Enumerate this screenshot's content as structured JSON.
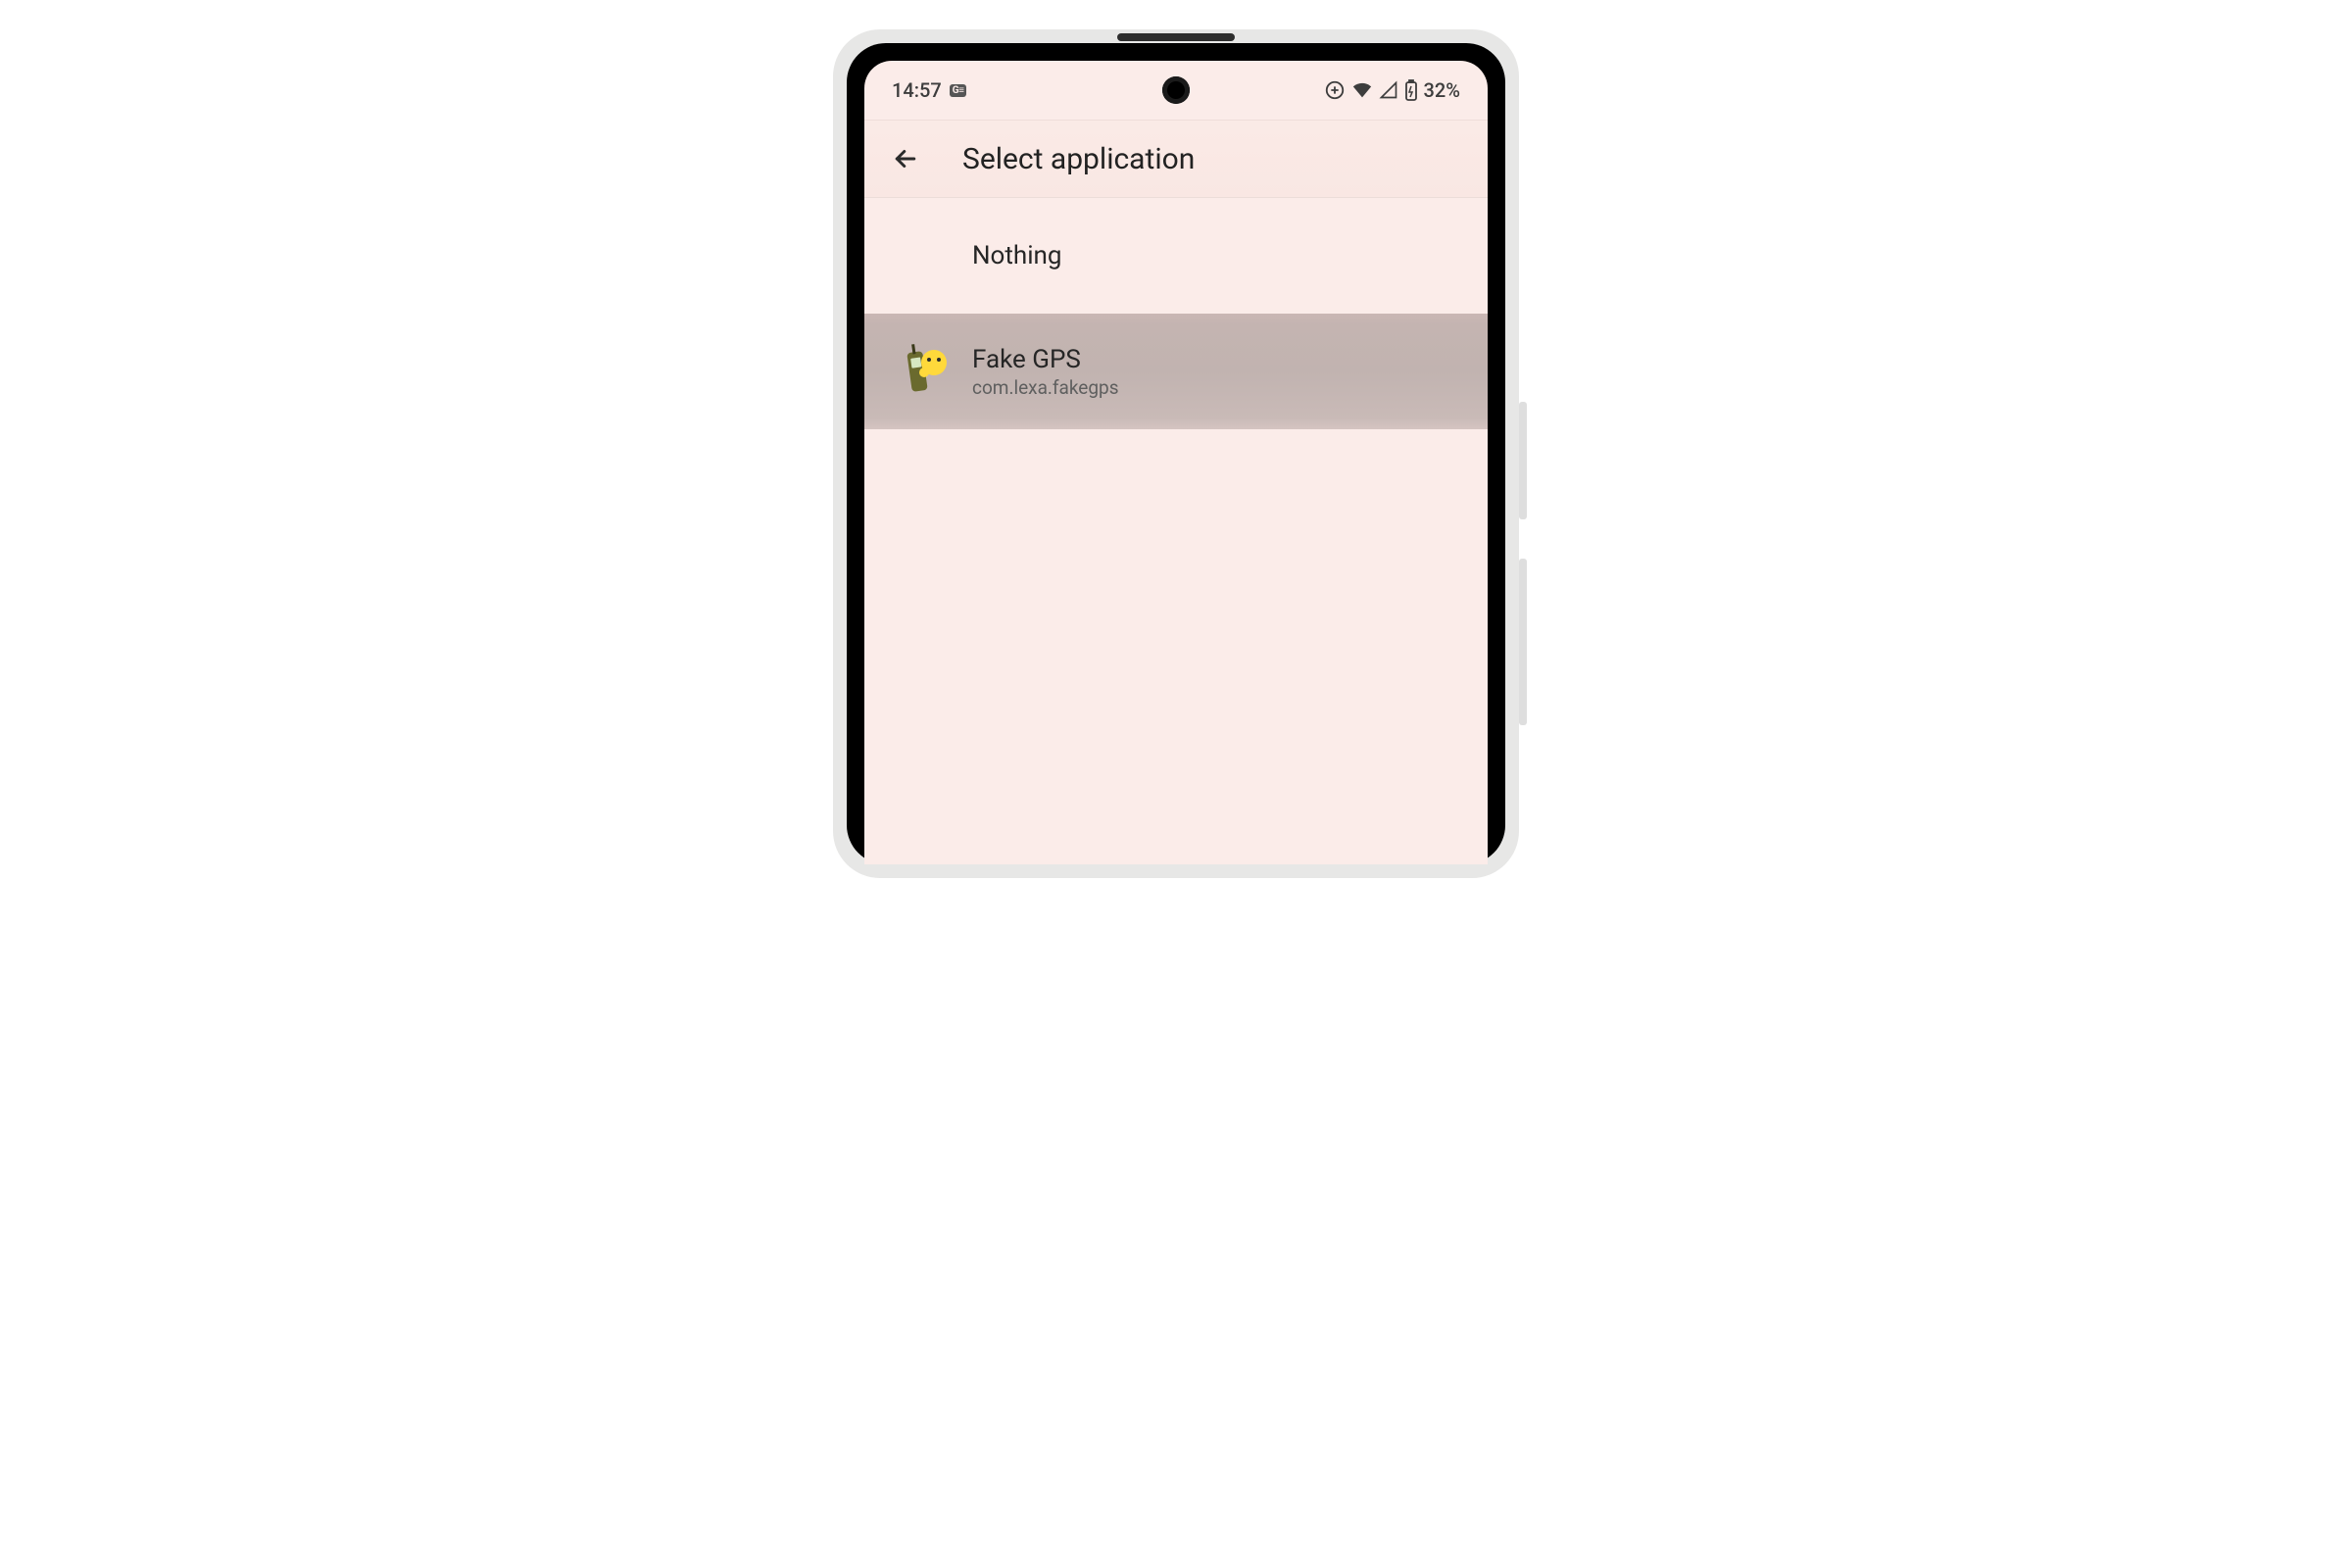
{
  "status": {
    "time": "14:57",
    "battery_text": "32%"
  },
  "header": {
    "title": "Select application"
  },
  "list": {
    "items": [
      {
        "title": "Nothing",
        "subtitle": "",
        "selected": false
      },
      {
        "title": "Fake GPS",
        "subtitle": "com.lexa.fakegps",
        "selected": true
      }
    ]
  }
}
